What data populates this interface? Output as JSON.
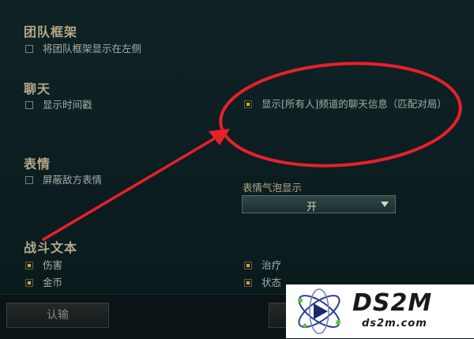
{
  "sections": {
    "team_frame": {
      "title": "团队框架",
      "options": [
        {
          "label": "将团队框架显示在左侧",
          "checked": false
        }
      ]
    },
    "chat": {
      "title": "聊天",
      "options": [
        {
          "label": "显示时间戳",
          "checked": false
        },
        {
          "label": "显示[所有人]频道的聊天信息（匹配对局）",
          "checked": true
        }
      ]
    },
    "emotes": {
      "title": "表情",
      "options": [
        {
          "label": "屏蔽敌方表情",
          "checked": false
        }
      ],
      "bubble_label": "表情气泡显示",
      "bubble_value": "开"
    },
    "combat_text": {
      "title": "战斗文本",
      "options": [
        {
          "label": "伤害",
          "checked": true
        },
        {
          "label": "治疗",
          "checked": true
        },
        {
          "label": "金币",
          "checked": true
        },
        {
          "label": "状态",
          "checked": true
        }
      ]
    }
  },
  "footer": {
    "surrender_label": "认输"
  },
  "annotation": {
    "color": "#e8202a"
  },
  "watermark": {
    "brand": "DS2M",
    "url": "ds2m.com"
  }
}
